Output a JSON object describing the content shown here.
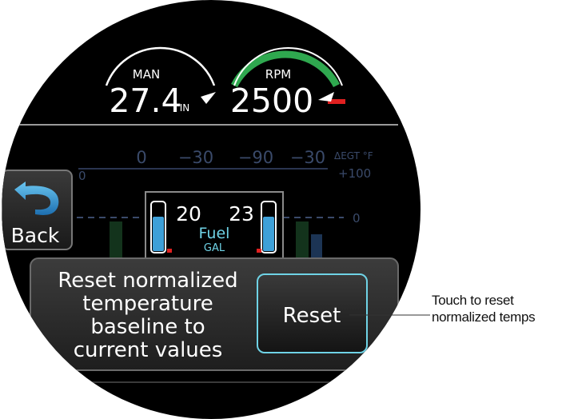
{
  "gauges": {
    "man": {
      "label": "MAN",
      "value": "27.4",
      "unit": "IN"
    },
    "rpm": {
      "label": "RPM",
      "value": "2500"
    }
  },
  "egt": {
    "values": [
      "0",
      "−30",
      "−90",
      "−30"
    ],
    "unit_label": "ΔEGT °F",
    "scale_top": "+100",
    "scale_mid": "0",
    "left_scale_top": "0",
    "left_scale_mid": "0"
  },
  "back_button": {
    "label": "Back"
  },
  "fuel": {
    "left": "20",
    "right": "23",
    "label": "Fuel",
    "unit": "GAL",
    "left_level": 0.72,
    "right_level": 0.72
  },
  "dialog": {
    "message_lines": [
      "Reset normalized",
      "temperature",
      "baseline to",
      "current values"
    ],
    "reset_label": "Reset"
  },
  "callout": {
    "lines": [
      "Touch to reset",
      "normalized temps"
    ]
  },
  "colors": {
    "screen_bg": "#000000",
    "arc_green": "#2fa84f",
    "redline": "#e02020",
    "fuel_blue": "#3ea0d8",
    "cyan_frame": "#6fd3e6",
    "egt_text": "#3a4a6a"
  }
}
